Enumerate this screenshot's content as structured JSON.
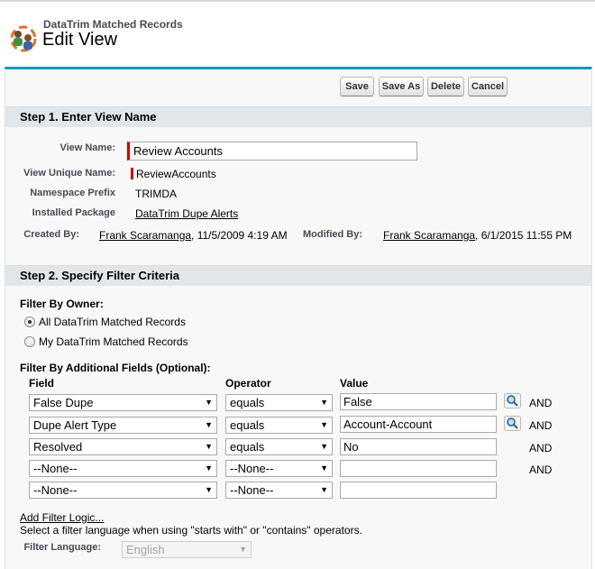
{
  "header": {
    "object_name": "DataTrim Matched Records",
    "title": "Edit View"
  },
  "toolbar": {
    "save": "Save",
    "save_as": "Save As",
    "delete": "Delete",
    "cancel": "Cancel"
  },
  "step1": {
    "title": "Step 1. Enter View Name",
    "view_name_label": "View Name:",
    "view_name_value": "Review Accounts",
    "unique_name_label": "View Unique Name:",
    "unique_name_value": "ReviewAccounts",
    "namespace_label": "Namespace Prefix",
    "namespace_value": "TRIMDA",
    "package_label": "Installed Package",
    "package_value": "DataTrim Dupe Alerts",
    "created_by_label": "Created By:",
    "created_by_user": "Frank Scaramanga",
    "created_by_date": ", 11/5/2009 4:19 AM",
    "modified_by_label": "Modified By:",
    "modified_by_user": "Frank Scaramanga",
    "modified_by_date": ", 6/1/2015 11:55 PM"
  },
  "step2": {
    "title": "Step 2. Specify Filter Criteria",
    "owner_label": "Filter By Owner:",
    "owner_options": [
      "All DataTrim Matched Records",
      "My DataTrim Matched Records"
    ],
    "owner_selected": 0,
    "additional_label": "Filter By Additional Fields (Optional):",
    "col_field": "Field",
    "col_operator": "Operator",
    "col_value": "Value",
    "rows": [
      {
        "field": "False Dupe",
        "operator": "equals",
        "value": "False",
        "lookup": true,
        "and": "AND"
      },
      {
        "field": "Dupe Alert Type",
        "operator": "equals",
        "value": "Account-Account",
        "lookup": true,
        "and": "AND"
      },
      {
        "field": "Resolved",
        "operator": "equals",
        "value": "No",
        "lookup": false,
        "and": "AND"
      },
      {
        "field": "--None--",
        "operator": "--None--",
        "value": "",
        "lookup": false,
        "and": "AND"
      },
      {
        "field": "--None--",
        "operator": "--None--",
        "value": "",
        "lookup": false,
        "and": ""
      }
    ],
    "add_logic": "Add Filter Logic...",
    "help_text": "Select a filter language when using \"starts with\" or \"contains\" operators.",
    "language_label": "Filter Language:",
    "language_value": "English"
  },
  "colors": {
    "accent": "#1797c0",
    "required": "#cc0000",
    "section_bg": "#e3e6e8"
  }
}
